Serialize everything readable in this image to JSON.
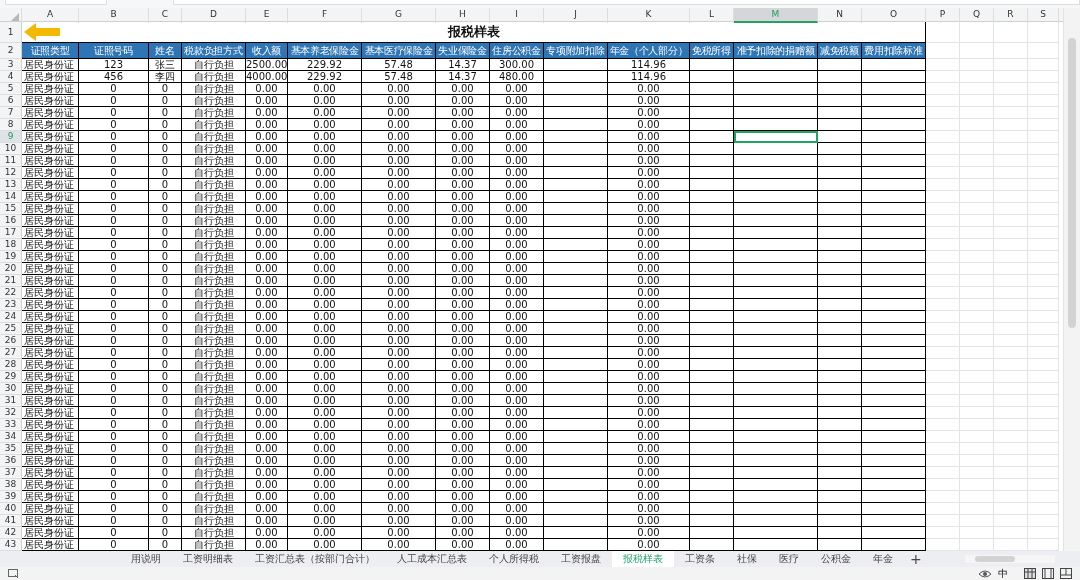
{
  "sheet": {
    "title": "报税样表",
    "title_row_number": "1",
    "header_row_number": "2",
    "columns": [
      {
        "letter": "A",
        "selected": false
      },
      {
        "letter": "B",
        "selected": false
      },
      {
        "letter": "C",
        "selected": false
      },
      {
        "letter": "D",
        "selected": false
      },
      {
        "letter": "E",
        "selected": false
      },
      {
        "letter": "F",
        "selected": false
      },
      {
        "letter": "G",
        "selected": false
      },
      {
        "letter": "H",
        "selected": false
      },
      {
        "letter": "I",
        "selected": false
      },
      {
        "letter": "J",
        "selected": false
      },
      {
        "letter": "K",
        "selected": false
      },
      {
        "letter": "L",
        "selected": false
      },
      {
        "letter": "M",
        "selected": true
      },
      {
        "letter": "N",
        "selected": false
      },
      {
        "letter": "O",
        "selected": false
      },
      {
        "letter": "P",
        "selected": false
      },
      {
        "letter": "Q",
        "selected": false
      },
      {
        "letter": "R",
        "selected": false
      },
      {
        "letter": "S",
        "selected": false
      }
    ],
    "header_row": [
      "证照类型",
      "证照号码",
      "姓名",
      "税款负担方式",
      "收入额",
      "基本养老保险金",
      "基本医疗保险金",
      "失业保险金",
      "住房公积金",
      "专项附加扣除",
      "年金（个人部分）",
      "免税所得",
      "准予扣除的捐赠额",
      "减免税额",
      "费用扣除标准"
    ],
    "rows": [
      {
        "num": "3",
        "selected": false,
        "cells": [
          "居民身份证",
          "123",
          "张三",
          "自行负担",
          "2500.00",
          "229.92",
          "57.48",
          "14.37",
          "300.00"
        ],
        "pension": "114.96"
      },
      {
        "num": "4",
        "selected": false,
        "cells": [
          "居民身份证",
          "456",
          "李四",
          "自行负担",
          "4000.00",
          "229.92",
          "57.48",
          "14.37",
          "480.00"
        ],
        "pension": "114.96"
      },
      {
        "num": "5",
        "selected": false,
        "cells": [
          "居民身份证",
          "0",
          "0",
          "自行负担",
          "0.00",
          "0.00",
          "0.00",
          "0.00",
          "0.00"
        ],
        "pension": "0.00"
      },
      {
        "num": "6",
        "selected": false,
        "cells": [
          "居民身份证",
          "0",
          "0",
          "自行负担",
          "0.00",
          "0.00",
          "0.00",
          "0.00",
          "0.00"
        ],
        "pension": "0.00"
      },
      {
        "num": "7",
        "selected": false,
        "cells": [
          "居民身份证",
          "0",
          "0",
          "自行负担",
          "0.00",
          "0.00",
          "0.00",
          "0.00",
          "0.00"
        ],
        "pension": "0.00"
      },
      {
        "num": "8",
        "selected": false,
        "cells": [
          "居民身份证",
          "0",
          "0",
          "自行负担",
          "0.00",
          "0.00",
          "0.00",
          "0.00",
          "0.00"
        ],
        "pension": "0.00"
      },
      {
        "num": "9",
        "selected": true,
        "cells": [
          "居民身份证",
          "0",
          "0",
          "自行负担",
          "0.00",
          "0.00",
          "0.00",
          "0.00",
          "0.00"
        ],
        "pension": "0.00"
      },
      {
        "num": "10",
        "selected": false,
        "cells": [
          "居民身份证",
          "0",
          "0",
          "自行负担",
          "0.00",
          "0.00",
          "0.00",
          "0.00",
          "0.00"
        ],
        "pension": "0.00"
      },
      {
        "num": "11",
        "selected": false,
        "cells": [
          "居民身份证",
          "0",
          "0",
          "自行负担",
          "0.00",
          "0.00",
          "0.00",
          "0.00",
          "0.00"
        ],
        "pension": "0.00"
      },
      {
        "num": "12",
        "selected": false,
        "cells": [
          "居民身份证",
          "0",
          "0",
          "自行负担",
          "0.00",
          "0.00",
          "0.00",
          "0.00",
          "0.00"
        ],
        "pension": "0.00"
      },
      {
        "num": "13",
        "selected": false,
        "cells": [
          "居民身份证",
          "0",
          "0",
          "自行负担",
          "0.00",
          "0.00",
          "0.00",
          "0.00",
          "0.00"
        ],
        "pension": "0.00"
      },
      {
        "num": "14",
        "selected": false,
        "cells": [
          "居民身份证",
          "0",
          "0",
          "自行负担",
          "0.00",
          "0.00",
          "0.00",
          "0.00",
          "0.00"
        ],
        "pension": "0.00"
      },
      {
        "num": "15",
        "selected": false,
        "cells": [
          "居民身份证",
          "0",
          "0",
          "自行负担",
          "0.00",
          "0.00",
          "0.00",
          "0.00",
          "0.00"
        ],
        "pension": "0.00"
      },
      {
        "num": "16",
        "selected": false,
        "cells": [
          "居民身份证",
          "0",
          "0",
          "自行负担",
          "0.00",
          "0.00",
          "0.00",
          "0.00",
          "0.00"
        ],
        "pension": "0.00"
      },
      {
        "num": "17",
        "selected": false,
        "cells": [
          "居民身份证",
          "0",
          "0",
          "自行负担",
          "0.00",
          "0.00",
          "0.00",
          "0.00",
          "0.00"
        ],
        "pension": "0.00"
      },
      {
        "num": "18",
        "selected": false,
        "cells": [
          "居民身份证",
          "0",
          "0",
          "自行负担",
          "0.00",
          "0.00",
          "0.00",
          "0.00",
          "0.00"
        ],
        "pension": "0.00"
      },
      {
        "num": "19",
        "selected": false,
        "cells": [
          "居民身份证",
          "0",
          "0",
          "自行负担",
          "0.00",
          "0.00",
          "0.00",
          "0.00",
          "0.00"
        ],
        "pension": "0.00"
      },
      {
        "num": "20",
        "selected": false,
        "cells": [
          "居民身份证",
          "0",
          "0",
          "自行负担",
          "0.00",
          "0.00",
          "0.00",
          "0.00",
          "0.00"
        ],
        "pension": "0.00"
      },
      {
        "num": "21",
        "selected": false,
        "cells": [
          "居民身份证",
          "0",
          "0",
          "自行负担",
          "0.00",
          "0.00",
          "0.00",
          "0.00",
          "0.00"
        ],
        "pension": "0.00"
      },
      {
        "num": "22",
        "selected": false,
        "cells": [
          "居民身份证",
          "0",
          "0",
          "自行负担",
          "0.00",
          "0.00",
          "0.00",
          "0.00",
          "0.00"
        ],
        "pension": "0.00"
      },
      {
        "num": "23",
        "selected": false,
        "cells": [
          "居民身份证",
          "0",
          "0",
          "自行负担",
          "0.00",
          "0.00",
          "0.00",
          "0.00",
          "0.00"
        ],
        "pension": "0.00"
      },
      {
        "num": "24",
        "selected": false,
        "cells": [
          "居民身份证",
          "0",
          "0",
          "自行负担",
          "0.00",
          "0.00",
          "0.00",
          "0.00",
          "0.00"
        ],
        "pension": "0.00"
      },
      {
        "num": "25",
        "selected": false,
        "cells": [
          "居民身份证",
          "0",
          "0",
          "自行负担",
          "0.00",
          "0.00",
          "0.00",
          "0.00",
          "0.00"
        ],
        "pension": "0.00"
      },
      {
        "num": "26",
        "selected": false,
        "cells": [
          "居民身份证",
          "0",
          "0",
          "自行负担",
          "0.00",
          "0.00",
          "0.00",
          "0.00",
          "0.00"
        ],
        "pension": "0.00"
      },
      {
        "num": "27",
        "selected": false,
        "cells": [
          "居民身份证",
          "0",
          "0",
          "自行负担",
          "0.00",
          "0.00",
          "0.00",
          "0.00",
          "0.00"
        ],
        "pension": "0.00"
      },
      {
        "num": "28",
        "selected": false,
        "cells": [
          "居民身份证",
          "0",
          "0",
          "自行负担",
          "0.00",
          "0.00",
          "0.00",
          "0.00",
          "0.00"
        ],
        "pension": "0.00"
      },
      {
        "num": "29",
        "selected": false,
        "cells": [
          "居民身份证",
          "0",
          "0",
          "自行负担",
          "0.00",
          "0.00",
          "0.00",
          "0.00",
          "0.00"
        ],
        "pension": "0.00"
      },
      {
        "num": "30",
        "selected": false,
        "cells": [
          "居民身份证",
          "0",
          "0",
          "自行负担",
          "0.00",
          "0.00",
          "0.00",
          "0.00",
          "0.00"
        ],
        "pension": "0.00"
      },
      {
        "num": "31",
        "selected": false,
        "cells": [
          "居民身份证",
          "0",
          "0",
          "自行负担",
          "0.00",
          "0.00",
          "0.00",
          "0.00",
          "0.00"
        ],
        "pension": "0.00"
      },
      {
        "num": "32",
        "selected": false,
        "cells": [
          "居民身份证",
          "0",
          "0",
          "自行负担",
          "0.00",
          "0.00",
          "0.00",
          "0.00",
          "0.00"
        ],
        "pension": "0.00"
      },
      {
        "num": "33",
        "selected": false,
        "cells": [
          "居民身份证",
          "0",
          "0",
          "自行负担",
          "0.00",
          "0.00",
          "0.00",
          "0.00",
          "0.00"
        ],
        "pension": "0.00"
      },
      {
        "num": "34",
        "selected": false,
        "cells": [
          "居民身份证",
          "0",
          "0",
          "自行负担",
          "0.00",
          "0.00",
          "0.00",
          "0.00",
          "0.00"
        ],
        "pension": "0.00"
      },
      {
        "num": "35",
        "selected": false,
        "cells": [
          "居民身份证",
          "0",
          "0",
          "自行负担",
          "0.00",
          "0.00",
          "0.00",
          "0.00",
          "0.00"
        ],
        "pension": "0.00"
      },
      {
        "num": "36",
        "selected": false,
        "cells": [
          "居民身份证",
          "0",
          "0",
          "自行负担",
          "0.00",
          "0.00",
          "0.00",
          "0.00",
          "0.00"
        ],
        "pension": "0.00"
      },
      {
        "num": "37",
        "selected": false,
        "cells": [
          "居民身份证",
          "0",
          "0",
          "自行负担",
          "0.00",
          "0.00",
          "0.00",
          "0.00",
          "0.00"
        ],
        "pension": "0.00"
      },
      {
        "num": "38",
        "selected": false,
        "cells": [
          "居民身份证",
          "0",
          "0",
          "自行负担",
          "0.00",
          "0.00",
          "0.00",
          "0.00",
          "0.00"
        ],
        "pension": "0.00"
      },
      {
        "num": "39",
        "selected": false,
        "cells": [
          "居民身份证",
          "0",
          "0",
          "自行负担",
          "0.00",
          "0.00",
          "0.00",
          "0.00",
          "0.00"
        ],
        "pension": "0.00"
      },
      {
        "num": "40",
        "selected": false,
        "cells": [
          "居民身份证",
          "0",
          "0",
          "自行负担",
          "0.00",
          "0.00",
          "0.00",
          "0.00",
          "0.00"
        ],
        "pension": "0.00"
      },
      {
        "num": "41",
        "selected": false,
        "cells": [
          "居民身份证",
          "0",
          "0",
          "自行负担",
          "0.00",
          "0.00",
          "0.00",
          "0.00",
          "0.00"
        ],
        "pension": "0.00"
      },
      {
        "num": "42",
        "selected": false,
        "cells": [
          "居民身份证",
          "0",
          "0",
          "自行负担",
          "0.00",
          "0.00",
          "0.00",
          "0.00",
          "0.00"
        ],
        "pension": "0.00"
      },
      {
        "num": "43",
        "selected": false,
        "cells": [
          "居民身份证",
          "0",
          "0",
          "自行负担",
          "0.00",
          "0.00",
          "0.00",
          "0.00",
          "0.00"
        ],
        "pension": "0.00"
      }
    ]
  },
  "tabs": [
    {
      "label": "用说明",
      "selected": false
    },
    {
      "label": "工资明细表",
      "selected": false
    },
    {
      "label": "工资汇总表（按部门合计）",
      "selected": false
    },
    {
      "label": "人工成本汇总表",
      "selected": false
    },
    {
      "label": "个人所得税",
      "selected": false
    },
    {
      "label": "工资报盘",
      "selected": false
    },
    {
      "label": "报税样表",
      "selected": true
    },
    {
      "label": "工资条",
      "selected": false
    },
    {
      "label": "社保",
      "selected": false
    },
    {
      "label": "医疗",
      "selected": false
    },
    {
      "label": "公积金",
      "selected": false
    },
    {
      "label": "年金",
      "selected": false
    }
  ],
  "add_tab": "+",
  "status_bar": {
    "input_mode": "中"
  }
}
